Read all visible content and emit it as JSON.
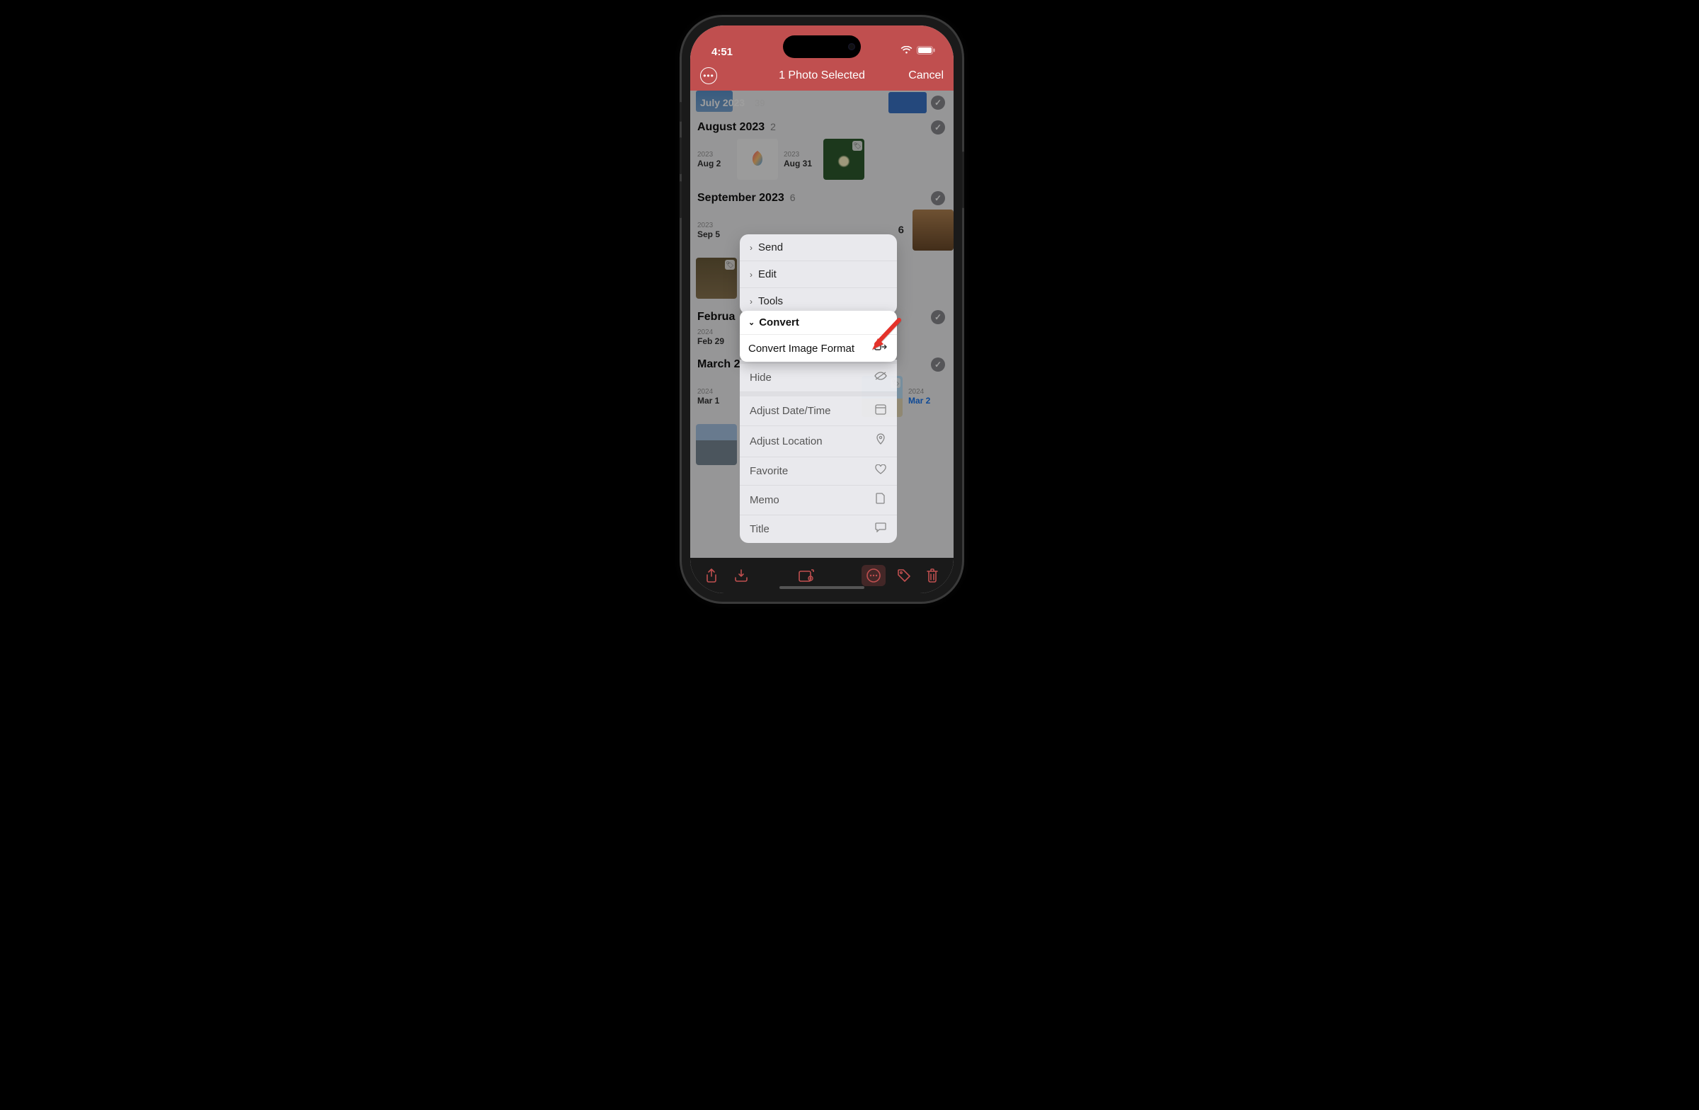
{
  "status": {
    "time": "4:51"
  },
  "nav": {
    "title": "1 Photo Selected",
    "cancel": "Cancel"
  },
  "sections": {
    "july": {
      "label": "July 2023",
      "count": "39"
    },
    "aug": {
      "label": "August 2023",
      "count": "2",
      "dates": [
        {
          "yr": "2023",
          "md": "Aug 2"
        },
        {
          "yr": "2023",
          "md": "Aug 31"
        }
      ]
    },
    "sep": {
      "label": "September 2023",
      "count": "6",
      "date": {
        "yr": "2023",
        "md": "Sep 5"
      },
      "badge": "6"
    },
    "feb": {
      "label": "Februa",
      "date": {
        "yr": "2024",
        "md": "Feb 29"
      }
    },
    "mar": {
      "label": "March 2",
      "dates": [
        {
          "yr": "2024",
          "md": "Mar 1"
        },
        {
          "yr": "2024",
          "md": "Mar 2"
        }
      ]
    }
  },
  "menu": {
    "send": "Send",
    "edit": "Edit",
    "tools": "Tools",
    "convert_header": "Convert",
    "convert_image_format": "Convert Image Format",
    "hide": "Hide",
    "adjust_date": "Adjust Date/Time",
    "adjust_location": "Adjust Location",
    "favorite": "Favorite",
    "memo": "Memo",
    "title": "Title"
  }
}
